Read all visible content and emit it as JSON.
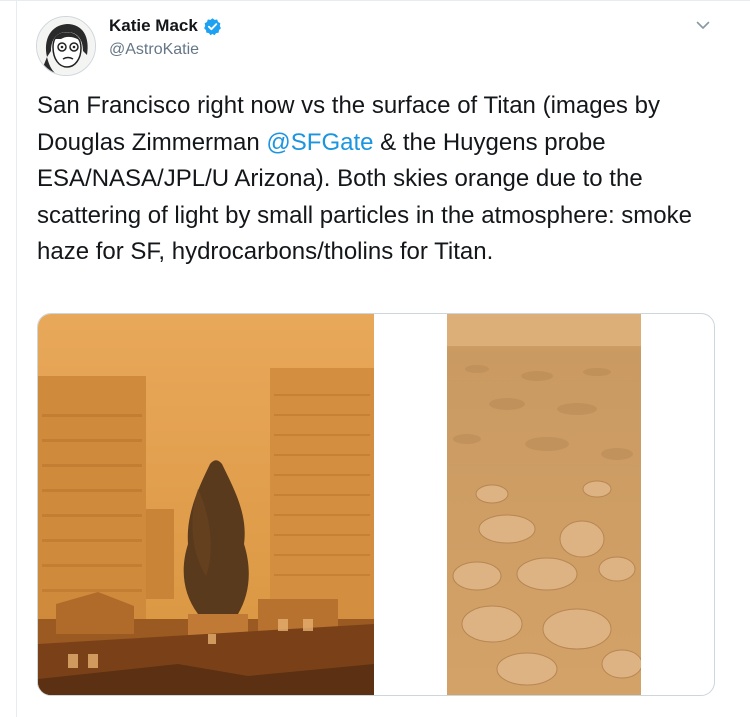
{
  "author": {
    "display_name": "Katie Mack",
    "handle": "@AstroKatie",
    "verified": true,
    "avatar_icon": "cartoon-avatar-icon"
  },
  "tweet": {
    "text_before_mention": "San Francisco right now vs the surface of Titan (images by Douglas Zimmerman ",
    "mention": "@SFGate",
    "text_after_mention": " & the Huygens probe ESA/NASA/JPL/U Arizona). Both skies orange due to the scattering of light by small particles in the atmosphere: smoke haze for SF, hydrocarbons/tholins for Titan."
  },
  "menu_icon": "chevron-down-icon",
  "colors": {
    "text": "#14171a",
    "secondary_text": "#657786",
    "link": "#1b95e0",
    "verified_badge": "#1da1f2",
    "sf_sky": "#e0a04f",
    "titan_surface": "#d4a15f"
  },
  "media": [
    {
      "subject": "san-francisco-orange-sky-photo"
    },
    {
      "subject": "titan-surface-huygens-photo"
    }
  ]
}
